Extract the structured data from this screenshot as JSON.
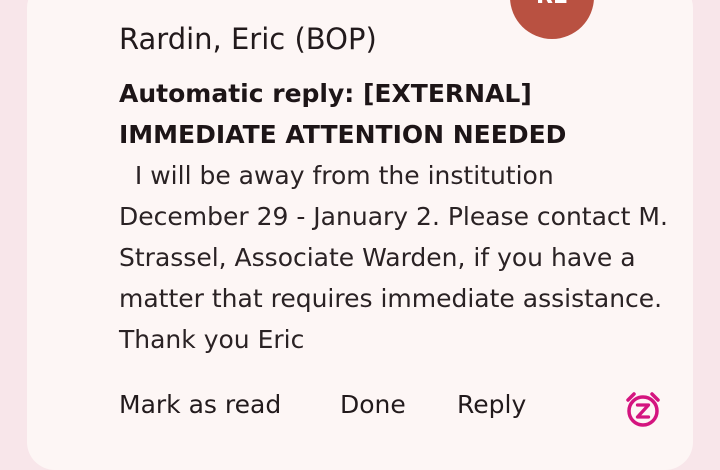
{
  "notification": {
    "avatar_initials": "RE",
    "sender": "Rardin, Eric (BOP)",
    "subject": "Automatic reply: [EXTERNAL] IMMEDIATE ATTENTION NEEDED",
    "body": "  I will be away from the institution December 29 - January 2. Please contact M. Strassel, Associate Warden, if you have a matter that requires immediate assistance. Thank you Eric",
    "actions": {
      "mark_as_read": "Mark as read",
      "done": "Done",
      "reply": "Reply"
    },
    "snooze_icon": "alarm-clock-z-icon"
  },
  "colors": {
    "background": "#f8e6ea",
    "card": "#fdf6f5",
    "avatar": "#b95141",
    "accent": "#d4147f"
  }
}
